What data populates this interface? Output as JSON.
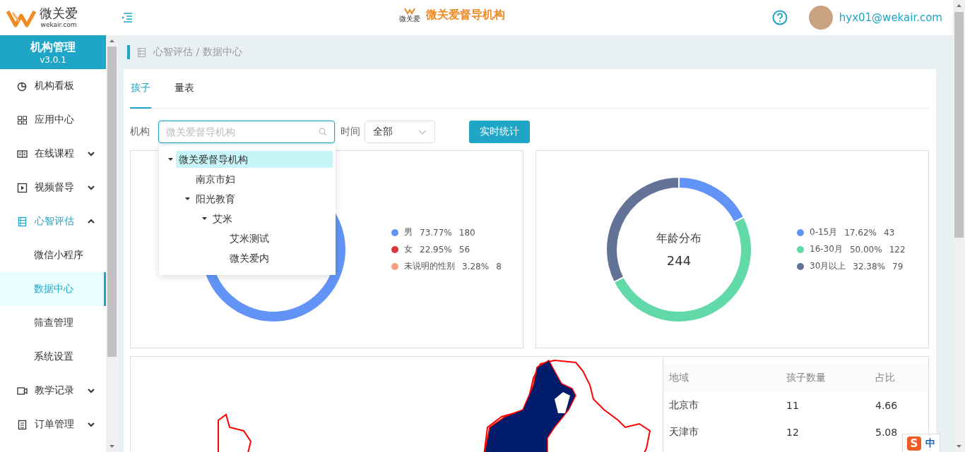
{
  "header": {
    "brand": "微关爱",
    "domain": "wekair.com",
    "logo_caption": "微关爱",
    "title": "微关爱督导机构",
    "user": "hyx01@wekair.com"
  },
  "sidebar": {
    "title": "机构管理",
    "version": "v3.0.1",
    "items": [
      {
        "label": "机构看板"
      },
      {
        "label": "应用中心"
      },
      {
        "label": "在线课程",
        "expanded": false
      },
      {
        "label": "视频督导",
        "expanded": false
      },
      {
        "label": "心智评估",
        "expanded": true,
        "children": [
          {
            "label": "微信小程序",
            "selected": false
          },
          {
            "label": "数据中心",
            "selected": true
          },
          {
            "label": "筛查管理",
            "selected": false
          },
          {
            "label": "系统设置",
            "selected": false
          }
        ]
      },
      {
        "label": "教学记录",
        "expanded": false
      },
      {
        "label": "订单管理",
        "expanded": false
      }
    ]
  },
  "breadcrumb": "心智评估 / 数据中心",
  "tabs": [
    {
      "label": "孩子",
      "selected": true
    },
    {
      "label": "量表",
      "selected": false
    }
  ],
  "filters": {
    "org_label": "机构",
    "org_placeholder": "微关爱督导机构",
    "time_label": "时间",
    "time_value": "全部",
    "button": "实时统计"
  },
  "org_tree": [
    {
      "label": "微关爱督导机构",
      "selected": true,
      "expanded": true,
      "children": [
        {
          "label": "南京市妇",
          "selected": false
        },
        {
          "label": "阳光教育",
          "selected": false,
          "expanded": true,
          "children": [
            {
              "label": "艾米",
              "selected": false,
              "expanded": true,
              "children": [
                {
                  "label": "艾米测试",
                  "selected": false
                },
                {
                  "label": "微关爱内",
                  "selected": false
                }
              ]
            }
          ]
        }
      ]
    }
  ],
  "charts": [
    {
      "legend": [
        {
          "label": "男",
          "percent": "73.77%",
          "count": "180",
          "color": "#6294f8"
        },
        {
          "label": "女",
          "percent": "22.95%",
          "count": "56",
          "color": "#d9363e"
        },
        {
          "label": "未说明的性别",
          "percent": "3.28%",
          "count": "8",
          "color": "#f4a07f"
        }
      ]
    },
    {
      "center_title": "年龄分布",
      "center_value": "244",
      "legend": [
        {
          "label": "0-15月",
          "percent": "17.62%",
          "count": "43",
          "color": "#6294f8"
        },
        {
          "label": "16-30月",
          "percent": "50.00%",
          "count": "122",
          "color": "#62d9a8"
        },
        {
          "label": "30月以上",
          "percent": "32.38%",
          "count": "79",
          "color": "#627397"
        }
      ]
    }
  ],
  "region_table": {
    "columns": [
      "地域",
      "孩子数量",
      "占比"
    ],
    "rows": [
      [
        "北京市",
        "11",
        "4.66"
      ],
      [
        "天津市",
        "12",
        "5.08"
      ]
    ]
  },
  "ime": {
    "logo": "S",
    "mode": "中"
  }
}
